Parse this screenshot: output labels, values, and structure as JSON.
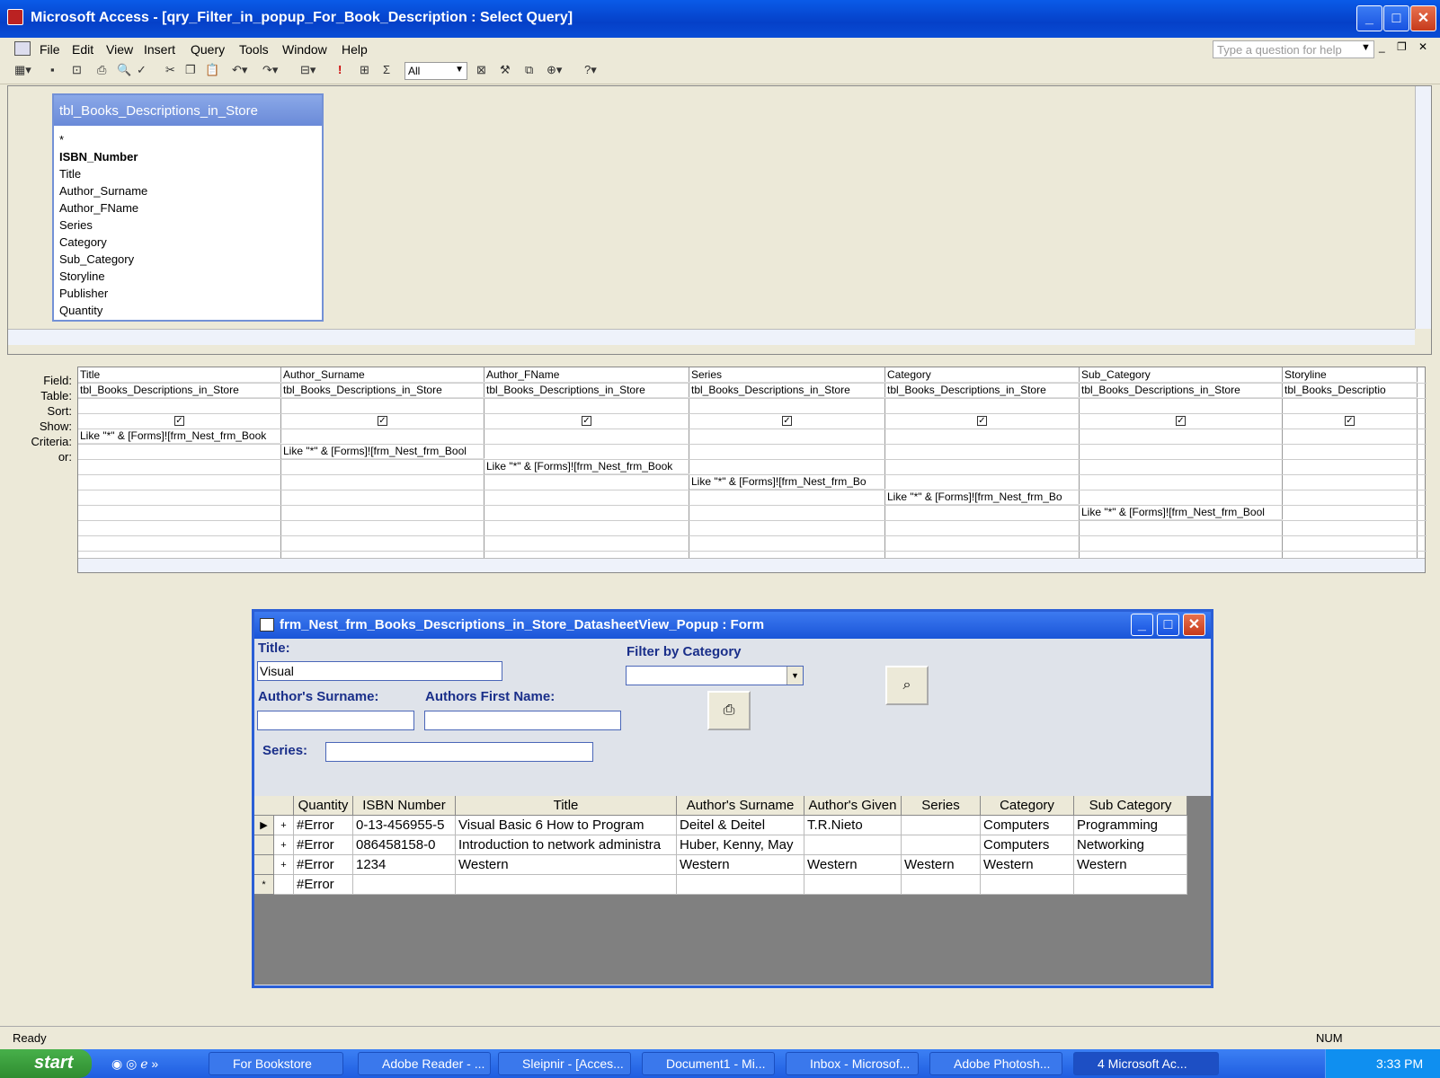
{
  "window": {
    "title": "Microsoft Access - [qry_Filter_in_popup_For_Book_Description : Select Query]"
  },
  "menu": {
    "items": [
      "File",
      "Edit",
      "View",
      "Insert",
      "Query",
      "Tools",
      "Window",
      "Help"
    ],
    "help_placeholder": "Type a question for help"
  },
  "toolbar": {
    "top_values": "All"
  },
  "table": {
    "name": "tbl_Books_Descriptions_in_Store",
    "fields": [
      "*",
      "ISBN_Number",
      "Title",
      "Author_Surname",
      "Author_FName",
      "Series",
      "Category",
      "Sub_Category",
      "Storyline",
      "Publisher",
      "Quantity"
    ]
  },
  "grid": {
    "row_labels": [
      "Field:",
      "Table:",
      "Sort:",
      "Show:",
      "Criteria:",
      "or:"
    ],
    "columns": [
      {
        "field": "Title",
        "table": "tbl_Books_Descriptions_in_Store",
        "criteria": "Like \"*\" & [Forms]![frm_Nest_frm_Book",
        "row": 0
      },
      {
        "field": "Author_Surname",
        "table": "tbl_Books_Descriptions_in_Store",
        "criteria": "Like \"*\" & [Forms]![frm_Nest_frm_Bool",
        "row": 1
      },
      {
        "field": "Author_FName",
        "table": "tbl_Books_Descriptions_in_Store",
        "criteria": "Like \"*\" & [Forms]![frm_Nest_frm_Book",
        "row": 2
      },
      {
        "field": "Series",
        "table": "tbl_Books_Descriptions_in_Store",
        "criteria": "Like \"*\" & [Forms]![frm_Nest_frm_Bo",
        "row": 3
      },
      {
        "field": "Category",
        "table": "tbl_Books_Descriptions_in_Store",
        "criteria": "Like \"*\" & [Forms]![frm_Nest_frm_Bo",
        "row": 4
      },
      {
        "field": "Sub_Category",
        "table": "tbl_Books_Descriptions_in_Store",
        "criteria": "Like \"*\" & [Forms]![frm_Nest_frm_Bool",
        "row": 5
      },
      {
        "field": "Storyline",
        "table": "tbl_Books_Descriptio",
        "criteria": "",
        "row": -1
      }
    ]
  },
  "popup": {
    "title": "frm_Nest_frm_Books_Descriptions_in_Store_DatasheetView_Popup : Form",
    "title_label": "Title:",
    "title_value": "Visual",
    "category_label": "Filter by Category",
    "category_value": "",
    "surname_label": "Author's Surname:",
    "surname_value": "",
    "firstname_label": "Authors First Name:",
    "firstname_value": "",
    "series_label": "Series:",
    "series_value": ""
  },
  "datasheet": {
    "headers": [
      "Quantity",
      "ISBN Number",
      "Title",
      "Author's Surname",
      "Author's Given",
      "Series",
      "Category",
      "Sub Category"
    ],
    "rows": [
      [
        "#Error",
        "0-13-456955-5",
        "Visual Basic 6 How to Program",
        "Deitel & Deitel",
        "T.R.Nieto",
        "",
        "Computers",
        "Programming"
      ],
      [
        "#Error",
        "086458158-0",
        "Introduction to network administra",
        "Huber, Kenny, May",
        "",
        "",
        "Computers",
        "Networking"
      ],
      [
        "#Error",
        "1234",
        "Western",
        "Western",
        "Western",
        "Western",
        "Western",
        "Western"
      ],
      [
        "#Error",
        "",
        "",
        "",
        "",
        "",
        "",
        ""
      ]
    ]
  },
  "status": {
    "left": "Ready",
    "right": "NUM"
  },
  "taskbar": {
    "start": "start",
    "tasks": [
      "For Bookstore",
      "Adobe Reader - ...",
      "Sleipnir - [Acces...",
      "Document1 - Mi...",
      "Inbox - Microsof...",
      "Adobe Photosh...",
      "4 Microsoft Ac..."
    ],
    "clock": "3:33 PM"
  }
}
